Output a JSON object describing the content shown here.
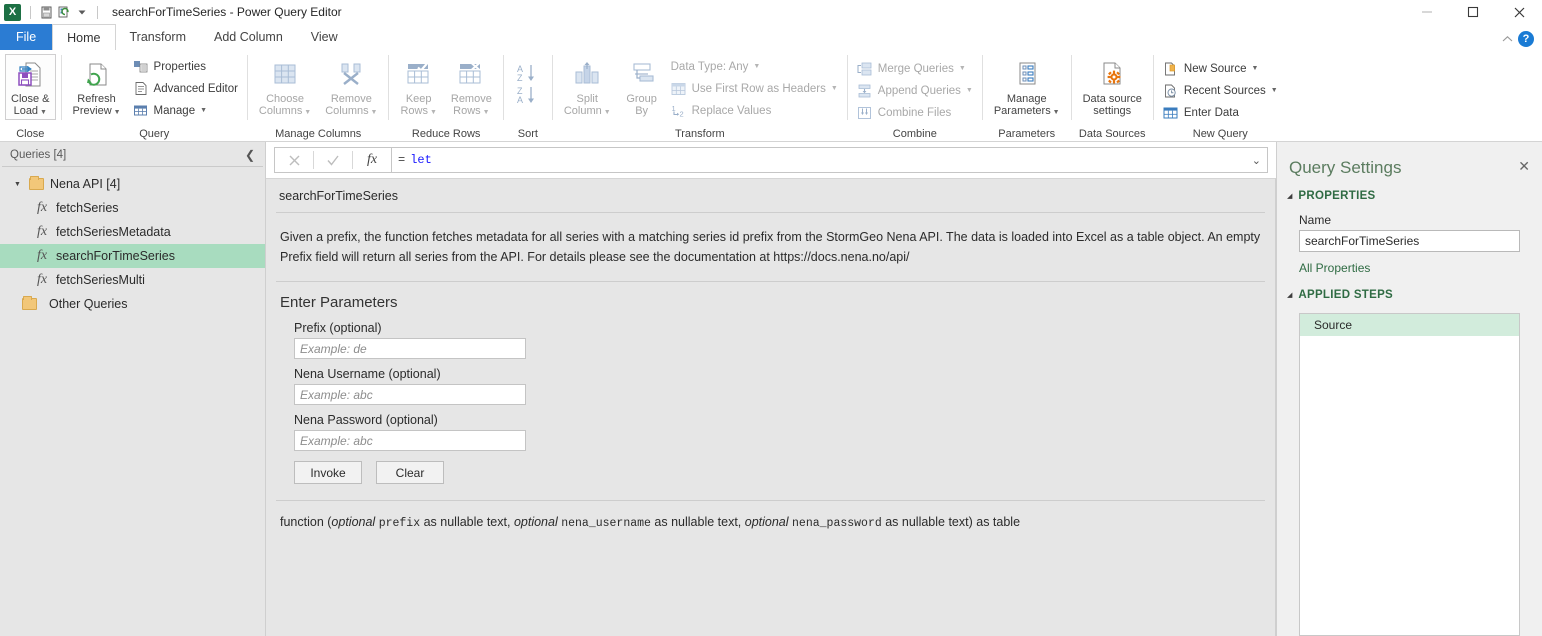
{
  "window": {
    "title": "searchForTimeSeries - Power Query Editor",
    "app_logo": "excel-logo",
    "logo_letter": "X",
    "quick_access": [
      "save-icon",
      "refresh-icon"
    ],
    "qat_dropdown": "customize-quick-access-toolbar-icon",
    "minimize": "minimize-icon",
    "maximize": "maximize-icon",
    "close": "close-icon"
  },
  "tabs": {
    "file": "File",
    "items": [
      "Home",
      "Transform",
      "Add Column",
      "View"
    ],
    "active": "Home",
    "collapse_ribbon": "chevron-up-icon",
    "help": "?"
  },
  "ribbon": {
    "groups": [
      {
        "label": "Close",
        "buttons": [
          {
            "label_line1": "Close &",
            "label_line2": "Load",
            "caret": true,
            "icon": "close-and-load-icon"
          }
        ]
      },
      {
        "label": "Query",
        "buttons": [
          {
            "label_line1": "Refresh",
            "label_line2": "Preview",
            "caret": true,
            "icon": "refresh-preview-icon"
          }
        ],
        "small_buttons": [
          {
            "label": "Properties",
            "icon": "properties-icon"
          },
          {
            "label": "Advanced Editor",
            "icon": "advanced-editor-icon"
          },
          {
            "label": "Manage",
            "icon": "manage-icon",
            "caret": true
          }
        ]
      },
      {
        "label": "Manage Columns",
        "buttons": [
          {
            "label_line1": "Choose",
            "label_line2": "Columns",
            "caret": true,
            "icon": "choose-columns-icon",
            "disabled": true
          },
          {
            "label_line1": "Remove",
            "label_line2": "Columns",
            "caret": true,
            "icon": "remove-columns-icon",
            "disabled": true
          }
        ]
      },
      {
        "label": "Reduce Rows",
        "buttons": [
          {
            "label_line1": "Keep",
            "label_line2": "Rows",
            "caret": true,
            "icon": "keep-rows-icon",
            "disabled": true
          },
          {
            "label_line1": "Remove",
            "label_line2": "Rows",
            "caret": true,
            "icon": "remove-rows-icon",
            "disabled": true
          }
        ]
      },
      {
        "label": "Sort",
        "buttons": [
          {
            "label_line1": "",
            "label_line2": "",
            "icon": "sort-ascending-descending-icon",
            "disabled": true
          }
        ]
      },
      {
        "label": "Transform",
        "buttons": [
          {
            "label_line1": "Split",
            "label_line2": "Column",
            "caret": true,
            "icon": "split-column-icon",
            "disabled": true
          },
          {
            "label_line1": "Group",
            "label_line2": "By",
            "icon": "group-by-icon",
            "disabled": true
          }
        ],
        "small_buttons": [
          {
            "label": "Data Type: Any",
            "icon": "data-type-icon",
            "caret": true,
            "disabled": true
          },
          {
            "label": "Use First Row as Headers",
            "icon": "use-first-row-as-headers-icon",
            "caret": true,
            "disabled": true
          },
          {
            "label": "Replace Values",
            "icon": "replace-values-icon",
            "disabled": true
          }
        ]
      },
      {
        "label": "Combine",
        "small_buttons": [
          {
            "label": "Merge Queries",
            "icon": "merge-queries-icon",
            "caret": true,
            "disabled": true
          },
          {
            "label": "Append Queries",
            "icon": "append-queries-icon",
            "caret": true,
            "disabled": true
          },
          {
            "label": "Combine Files",
            "icon": "combine-files-icon",
            "disabled": true
          }
        ]
      },
      {
        "label": "Parameters",
        "buttons": [
          {
            "label_line1": "Manage",
            "label_line2": "Parameters",
            "caret": true,
            "icon": "manage-parameters-icon"
          }
        ]
      },
      {
        "label": "Data Sources",
        "buttons": [
          {
            "label_line1": "Data source",
            "label_line2": "settings",
            "icon": "data-source-settings-icon"
          }
        ]
      },
      {
        "label": "New Query",
        "small_buttons": [
          {
            "label": "New Source",
            "icon": "new-source-icon",
            "caret": true
          },
          {
            "label": "Recent Sources",
            "icon": "recent-sources-icon",
            "caret": true
          },
          {
            "label": "Enter Data",
            "icon": "enter-data-icon"
          }
        ]
      }
    ]
  },
  "queries_pane": {
    "header": "Queries [4]",
    "collapse_icon": "collapse-pane-icon",
    "group": {
      "label": "Nena API [4]",
      "expanded": true
    },
    "items": [
      {
        "label": "fetchSeries",
        "icon": "function-icon",
        "selected": false
      },
      {
        "label": "fetchSeriesMetadata",
        "icon": "function-icon",
        "selected": false
      },
      {
        "label": "searchForTimeSeries",
        "icon": "function-icon",
        "selected": true
      },
      {
        "label": "fetchSeriesMulti",
        "icon": "function-icon",
        "selected": false
      }
    ],
    "other_group": "Other Queries"
  },
  "formula_bar": {
    "cancel_icon": "cancel-icon",
    "accept_icon": "accept-icon",
    "fx_icon": "fx-icon",
    "equals": "=",
    "value": "let",
    "expand_icon": "chevron-down-icon"
  },
  "main": {
    "function_name": "searchForTimeSeries",
    "description": "Given a prefix, the function fetches metadata for all series with a matching series id prefix from the StormGeo Nena API. The data is loaded into Excel as a table object. An empty Prefix field will return all series from the API. For details please see the documentation at https://docs.nena.no/api/",
    "params_title": "Enter Parameters",
    "fields": [
      {
        "label": "Prefix (optional)",
        "value": "",
        "placeholder": "Example: de",
        "name": "prefix-input"
      },
      {
        "label": "Nena Username (optional)",
        "value": "",
        "placeholder": "Example: abc",
        "name": "nena-username-input"
      },
      {
        "label": "Nena Password (optional)",
        "value": "",
        "placeholder": "Example: abc",
        "name": "nena-password-input"
      }
    ],
    "invoke_label": "Invoke",
    "clear_label": "Clear",
    "signature": {
      "prefix_text": "function (",
      "parts": [
        {
          "optional": "optional",
          "name": "prefix",
          "type": " as nullable text, "
        },
        {
          "optional": "optional",
          "name": "nena_username",
          "type": " as nullable text, "
        },
        {
          "optional": "optional",
          "name": "nena_password",
          "type": " as nullable text"
        }
      ],
      "suffix_text": ") as table"
    }
  },
  "query_settings": {
    "title": "Query Settings",
    "close_icon": "close-icon",
    "properties_section": "PROPERTIES",
    "name_label": "Name",
    "name_value": "searchForTimeSeries",
    "all_properties_link": "All Properties",
    "applied_steps_section": "APPLIED STEPS",
    "steps": [
      {
        "label": "Source",
        "selected": true
      }
    ]
  },
  "colors": {
    "file_tab_blue": "#2b7cd3",
    "selected_query_green": "#a8dcbf",
    "settings_heading_green": "#2f6b43",
    "step_selected_green": "#d2ecdc",
    "panel_gray": "#e6e6e6",
    "excel_green": "#1d7044",
    "formula_blue": "#1a1aff"
  }
}
